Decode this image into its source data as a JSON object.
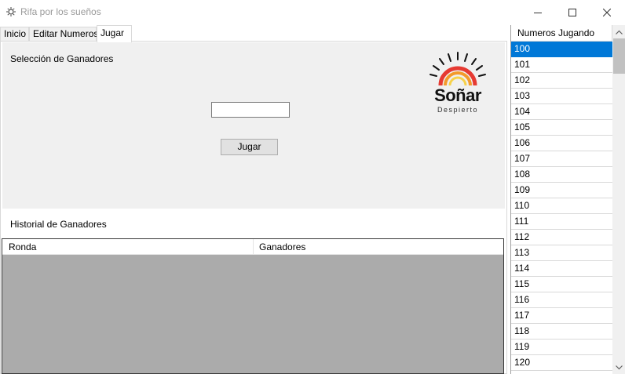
{
  "window": {
    "title": "Rifa por los sueños",
    "icon": "app-icon",
    "controls": [
      "minimize-icon",
      "maximize-icon",
      "close-icon"
    ]
  },
  "tabs": [
    {
      "label": "Inicio",
      "selected": false
    },
    {
      "label": "Editar Numeros",
      "selected": false
    },
    {
      "label": "Jugar",
      "selected": true
    }
  ],
  "seleccion": {
    "label": "Selección de Ganadores",
    "input_value": "",
    "button_label": "Jugar"
  },
  "logo": {
    "brand": "Soñar",
    "tagline": "Despierto",
    "colors": {
      "red": "#e63a32",
      "orange": "#f39a2b",
      "yellow": "#f7d24a",
      "black": "#111111"
    }
  },
  "historial": {
    "label": "Historial de Ganadores",
    "columns": [
      "Ronda",
      "Ganadores"
    ],
    "rows": []
  },
  "numeros": {
    "header": "Numeros Jugando",
    "selected": "100",
    "items": [
      "100",
      "101",
      "102",
      "103",
      "104",
      "105",
      "106",
      "107",
      "108",
      "109",
      "110",
      "111",
      "112",
      "113",
      "114",
      "115",
      "116",
      "117",
      "118",
      "119",
      "120"
    ]
  },
  "colors": {
    "selection": "#0078d7",
    "grid_background": "#ababab",
    "panel": "#f0f0f0"
  }
}
